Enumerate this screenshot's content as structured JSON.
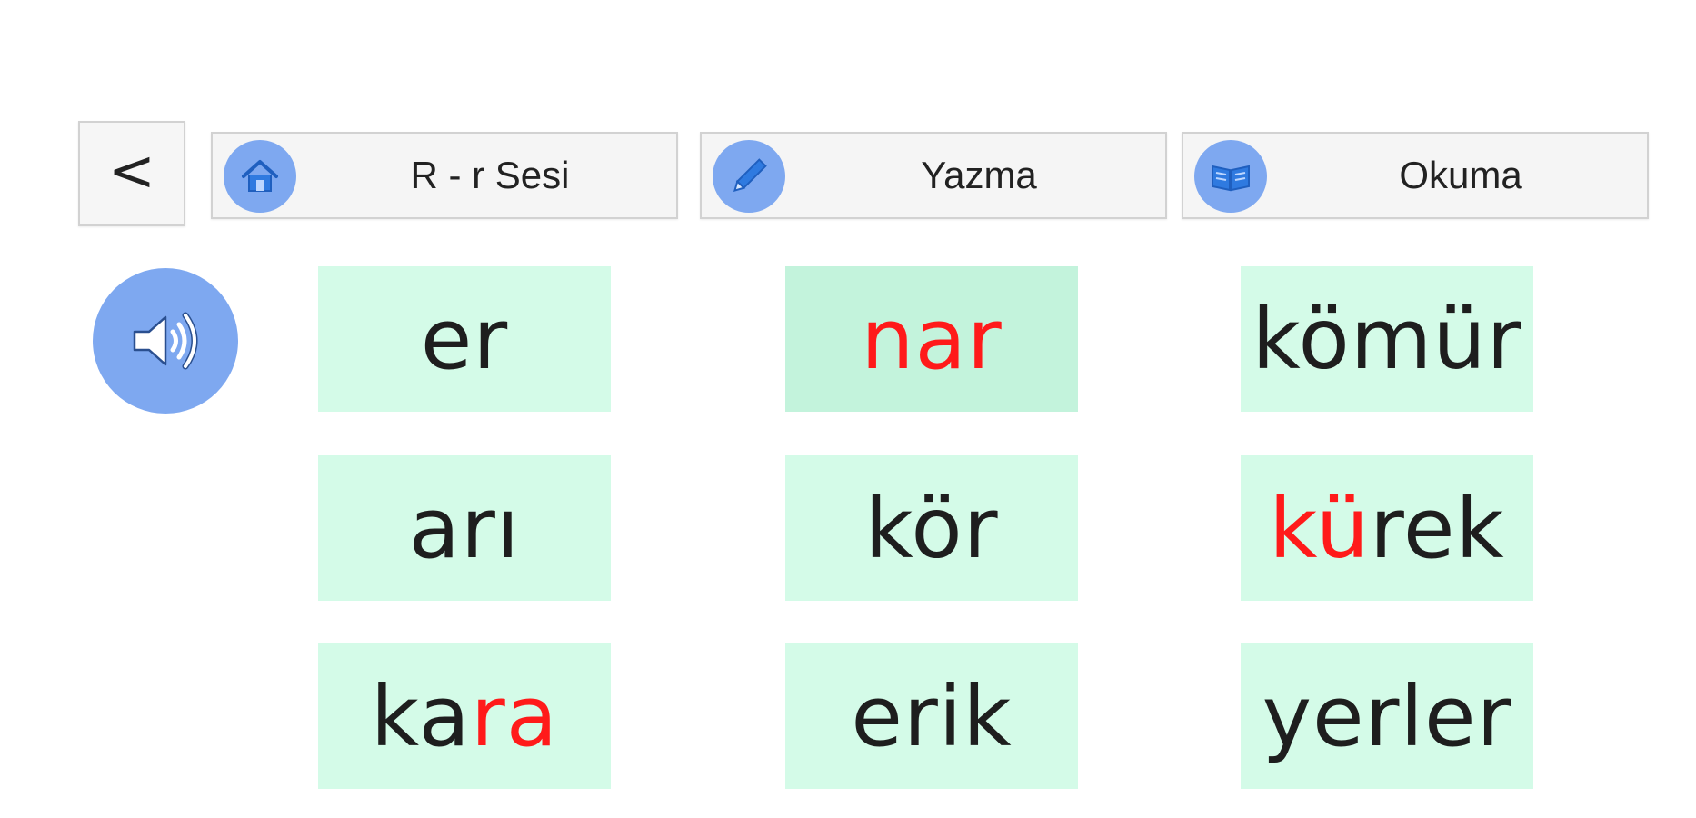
{
  "nav": {
    "back_label": "<",
    "home": {
      "label": "R - r Sesi",
      "icon": "home-icon"
    },
    "writing": {
      "label": "Yazma",
      "icon": "pencil-icon"
    },
    "reading": {
      "label": "Okuma",
      "icon": "book-icon"
    }
  },
  "speaker": {
    "icon": "speaker-icon"
  },
  "colors": {
    "card_bg": "#d4fbe8",
    "card_selected_bg": "#c3f3dc",
    "icon_circle": "#7ea8f0",
    "highlight": "#ff1a1a",
    "text": "#1e1e1e"
  },
  "words": [
    {
      "parts": [
        {
          "text": "er",
          "highlight": false
        }
      ],
      "selected": false
    },
    {
      "parts": [
        {
          "text": "nar",
          "highlight": true
        }
      ],
      "selected": true
    },
    {
      "parts": [
        {
          "text": "kömür",
          "highlight": false
        }
      ],
      "selected": false
    },
    {
      "parts": [
        {
          "text": "arı",
          "highlight": false
        }
      ],
      "selected": false
    },
    {
      "parts": [
        {
          "text": "kör",
          "highlight": false
        }
      ],
      "selected": false
    },
    {
      "parts": [
        {
          "text": "kü",
          "highlight": true
        },
        {
          "text": "rek",
          "highlight": false
        }
      ],
      "selected": false
    },
    {
      "parts": [
        {
          "text": "ka",
          "highlight": false
        },
        {
          "text": "ra",
          "highlight": true
        }
      ],
      "selected": false
    },
    {
      "parts": [
        {
          "text": "erik",
          "highlight": false
        }
      ],
      "selected": false
    },
    {
      "parts": [
        {
          "text": "yerler",
          "highlight": false
        }
      ],
      "selected": false
    }
  ]
}
